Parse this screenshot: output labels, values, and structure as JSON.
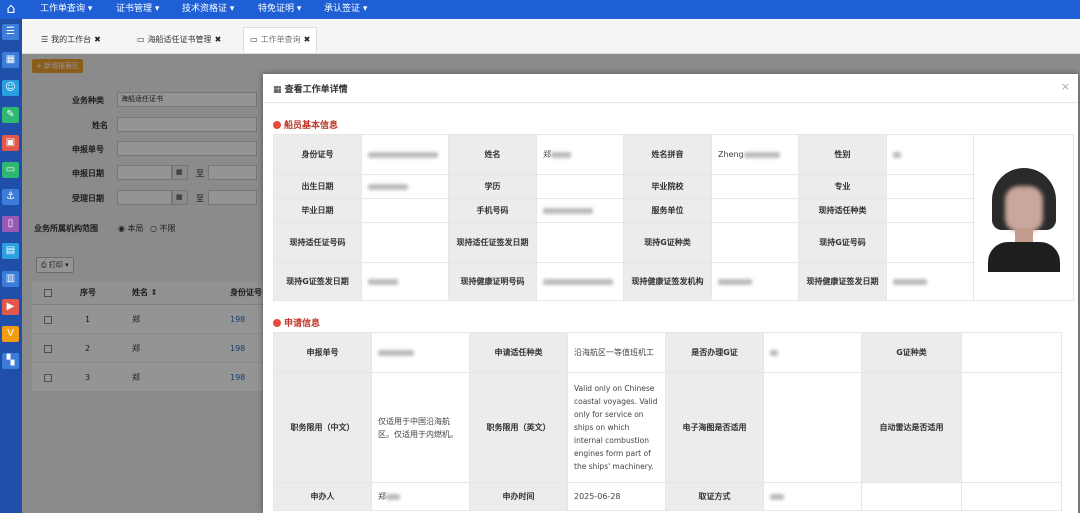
{
  "topnav": {
    "home_icon": "home-icon",
    "menus": [
      "工作单查询",
      "证书管理",
      "技术资格证",
      "特免证明",
      "承认签证"
    ]
  },
  "leftbar": {
    "icons": [
      {
        "name": "list-icon",
        "color": "#3b7dd8"
      },
      {
        "name": "grid-icon",
        "color": "#3b7dd8"
      },
      {
        "name": "users-icon",
        "color": "#2aa0e0"
      },
      {
        "name": "edit-icon",
        "color": "#2eb872"
      },
      {
        "name": "certificate-icon",
        "color": "#e2574c"
      },
      {
        "name": "inbox-icon",
        "color": "#2eb872"
      },
      {
        "name": "anchor-icon",
        "color": "#3b7dd8"
      },
      {
        "name": "document-icon",
        "color": "#9b59b6"
      },
      {
        "name": "chart-icon",
        "color": "#2aa0e0"
      },
      {
        "name": "book-icon",
        "color": "#3b7dd8"
      },
      {
        "name": "video-icon",
        "color": "#e2574c"
      },
      {
        "name": "v-icon",
        "color": "#f39c12"
      },
      {
        "name": "apps-icon",
        "color": "#3b7dd8"
      }
    ]
  },
  "tabs": [
    {
      "label": "我的工作台",
      "icon": "list-icon"
    },
    {
      "label": "海船适任证书管理",
      "icon": "card-icon"
    },
    {
      "label": "工作单查询",
      "icon": "card-icon",
      "active": true
    }
  ],
  "bg": {
    "add_button": "+ 新增报表区",
    "fields": {
      "business_type_label": "业务种类",
      "business_type_value": "海船适任证书",
      "name_label": "姓名",
      "report_no_label": "申报单号",
      "report_date_label": "申报日期",
      "accept_date_label": "受理日期",
      "to": "至"
    },
    "scope_label": "业务所属机构范围",
    "scope_options": [
      "本局",
      "不限"
    ],
    "print_button": "打印",
    "table": {
      "headers": [
        "序号",
        "姓名 ⇕",
        "身份证号"
      ],
      "rows": [
        {
          "no": "1",
          "name": "郑",
          "id": "198"
        },
        {
          "no": "2",
          "name": "郑",
          "id": "198"
        },
        {
          "no": "3",
          "name": "郑",
          "id": "198"
        }
      ]
    }
  },
  "modal": {
    "title": "查看工作单详情",
    "close": "×",
    "section1": "船员基本信息",
    "section2": "申请信息",
    "basic": {
      "id_label": "身份证号",
      "name_label": "姓名",
      "name_value": "郑",
      "pinyin_label": "姓名拼音",
      "pinyin_value": "Zheng",
      "gender_label": "性别",
      "birth_label": "出生日期",
      "education_label": "学历",
      "school_label": "毕业院校",
      "major_label": "专业",
      "grad_date_label": "毕业日期",
      "phone_label": "手机号码",
      "employer_label": "服务单位",
      "cert_type_label": "现持适任种类",
      "cert_no_label": "现持适任证号码",
      "cert_issue_label": "现持适任证签发日期",
      "gcert_type_label": "现持G证种类",
      "gcert_no_label": "现持G证号码",
      "gcert_issue_label": "现持G证签发日期",
      "health_no_label": "现持健康证明号码",
      "health_org_label": "现持健康证签发机构",
      "health_issue_label": "现持健康证签发日期"
    },
    "apply": {
      "report_no_label": "申报单号",
      "apply_type_label": "申请适任种类",
      "apply_type_value": "沿海航区一等值班机工",
      "g_cert_label": "是否办理G证",
      "g_type_label": "G证种类",
      "limit_cn_label": "职务限用（中文）",
      "limit_cn_value": "仅适用于中国沿海航区。仅适用于内燃机。",
      "limit_en_label": "职务限用（英文）",
      "limit_en_value": "Valid only on Chinese coastal voyages. Valid only for service on ships on which internal combustion engines form part of the ships' machinery.",
      "ecdis_label": "电子海图是否适用",
      "radar_label": "自动雷达是否适用",
      "applicant_label": "申办人",
      "applicant_value": "郑",
      "apply_time_label": "申办时间",
      "apply_time_value": "2025-06-28",
      "receive_label": "取证方式"
    }
  }
}
